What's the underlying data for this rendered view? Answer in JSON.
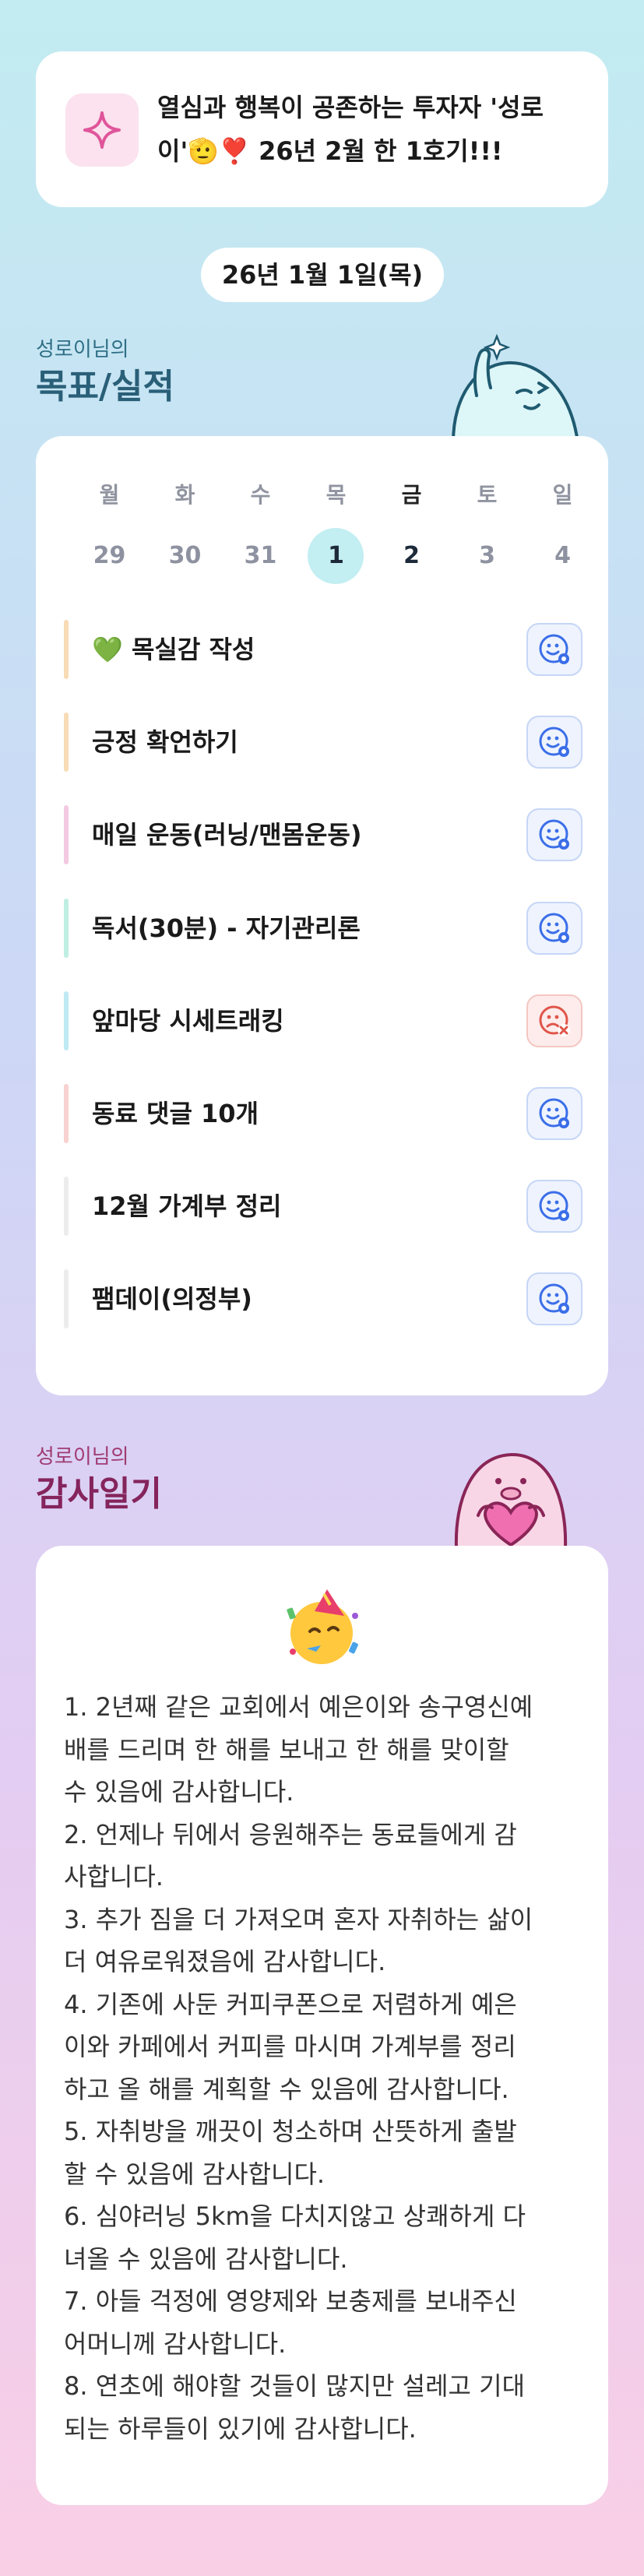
{
  "header": {
    "title": "열심과 행복이 공존하는 투자자 '성로이'🫡❣️ 26년 2월 한 1호기!!!"
  },
  "date_pill": "26년 1월 1일(목)",
  "goals": {
    "subtitle": "성로이님의",
    "title": "목표/실적",
    "weekdays": [
      "월",
      "화",
      "수",
      "목",
      "금",
      "토",
      "일"
    ],
    "days": [
      "29",
      "30",
      "31",
      "1",
      "2",
      "3",
      "4"
    ],
    "items": [
      {
        "label": "💚 목실감 작성",
        "bar_color": "#f7dcb6",
        "status": "done"
      },
      {
        "label": "긍정 확언하기",
        "bar_color": "#f7dcb6",
        "status": "done"
      },
      {
        "label": "매일 운동(러닝/맨몸운동)",
        "bar_color": "#f4c9e2",
        "status": "done"
      },
      {
        "label": "독서(30분) - 자기관리론",
        "bar_color": "#bfeee3",
        "status": "done"
      },
      {
        "label": "앞마당 시세트래킹",
        "bar_color": "#bfeaf3",
        "status": "fail"
      },
      {
        "label": "동료 댓글 10개",
        "bar_color": "#f8d2d0",
        "status": "done"
      },
      {
        "label": "12월 가계부 정리",
        "bar_color": "#ececec",
        "status": "done"
      },
      {
        "label": "팸데이(의정부)",
        "bar_color": "#ececec",
        "status": "done"
      }
    ]
  },
  "thanks": {
    "subtitle": "성로이님의",
    "title": "감사일기",
    "lines": [
      "1. 2년째 같은 교회에서 예은이와 송구영신예",
      "배를 드리며 한 해를 보내고 한 해를 맞이할",
      "수 있음에 감사합니다.",
      "2. 언제나 뒤에서 응원해주는 동료들에게 감",
      "사합니다.",
      "3. 추가 짐을 더 가져오며 혼자 자취하는 삶이",
      "더 여유로워졌음에 감사합니다.",
      "4. 기존에 사둔 커피쿠폰으로 저렴하게 예은",
      "이와 카페에서 커피를 마시며 가계부를 정리",
      "하고 올 해를 계획할 수 있음에 감사합니다.",
      "5. 자취방을 깨끗이 청소하며 산뜻하게 출발",
      "할 수 있음에 감사합니다.",
      "6. 심야러닝 5km을 다치지않고 상쾌하게 다",
      "녀올 수 있음에 감사합니다.",
      "7. 아들 걱정에 영양제와 보충제를 보내주신",
      "어머니께 감사합니다.",
      "8. 연초에 해야할 것들이 많지만 설레고 기대",
      "되는 하루들이 있기에 감사합니다."
    ]
  },
  "colors": {
    "status_done": "#3b6ee8",
    "status_fail": "#e0554a",
    "today_circle": "#c3eef2"
  }
}
